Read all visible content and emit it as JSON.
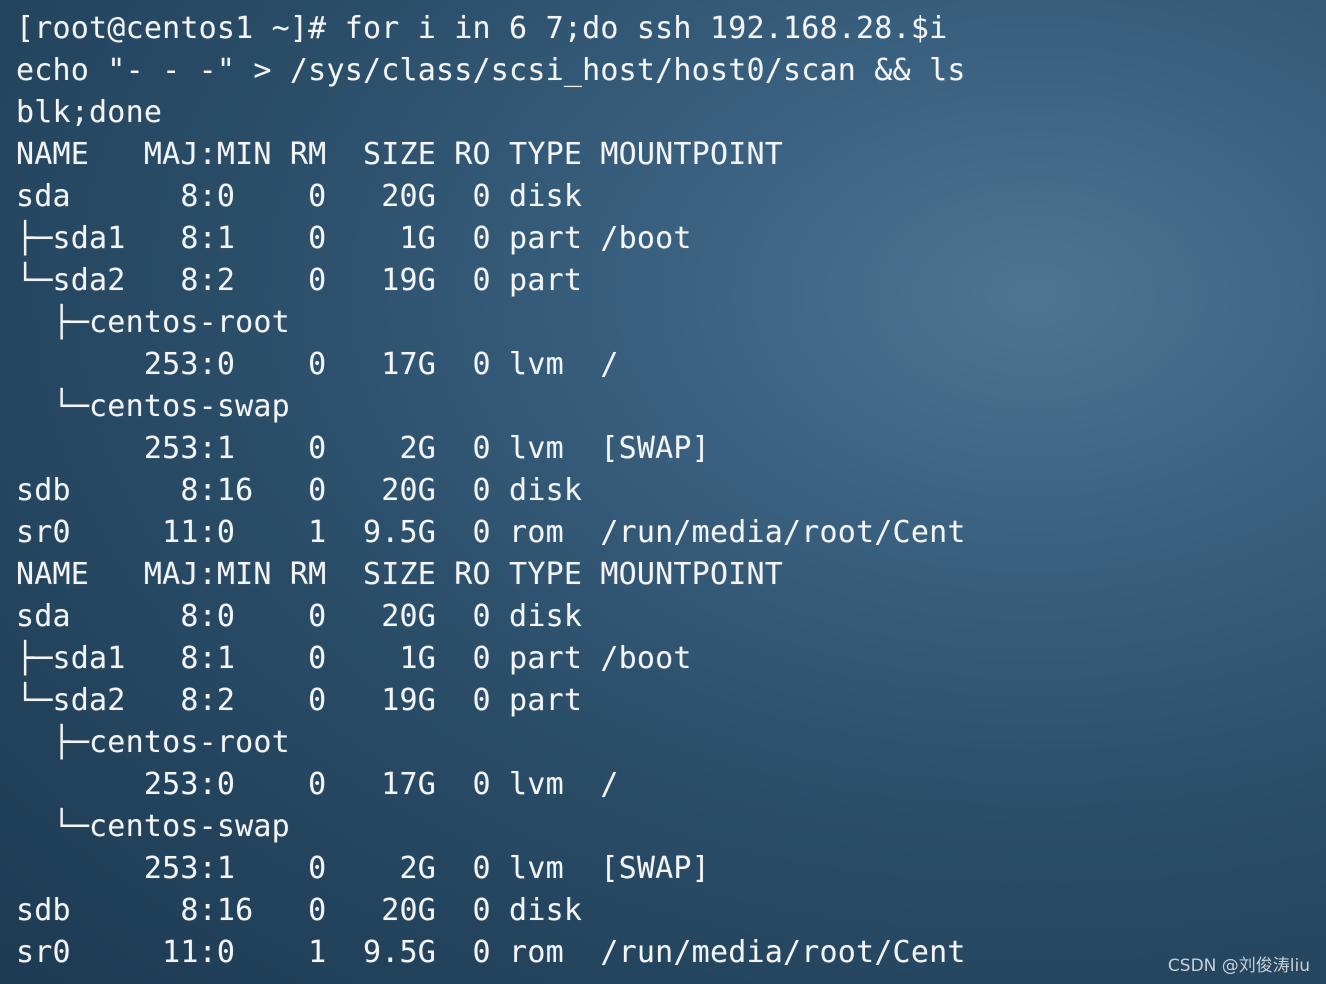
{
  "terminal": {
    "lines": [
      "[root@centos1 ~]# for i in 6 7;do ssh 192.168.28.$i",
      "echo \"- - -\" > /sys/class/scsi_host/host0/scan && ls",
      "blk;done",
      "NAME   MAJ:MIN RM  SIZE RO TYPE MOUNTPOINT",
      "sda      8:0    0   20G  0 disk",
      "├─sda1   8:1    0    1G  0 part /boot",
      "└─sda2   8:2    0   19G  0 part",
      "  ├─centos-root",
      "       253:0    0   17G  0 lvm  /",
      "  └─centos-swap",
      "       253:1    0    2G  0 lvm  [SWAP]",
      "sdb      8:16   0   20G  0 disk",
      "sr0     11:0    1  9.5G  0 rom  /run/media/root/Cent",
      "NAME   MAJ:MIN RM  SIZE RO TYPE MOUNTPOINT",
      "sda      8:0    0   20G  0 disk",
      "├─sda1   8:1    0    1G  0 part /boot",
      "└─sda2   8:2    0   19G  0 part",
      "  ├─centos-root",
      "       253:0    0   17G  0 lvm  /",
      "  └─centos-swap",
      "       253:1    0    2G  0 lvm  [SWAP]",
      "sdb      8:16   0   20G  0 disk",
      "sr0     11:0    1  9.5G  0 rom  /run/media/root/Cent"
    ]
  },
  "watermark": "CSDN @刘俊涛liu",
  "colors": {
    "text": "#f2f4f6",
    "background": "#2a4d68"
  }
}
